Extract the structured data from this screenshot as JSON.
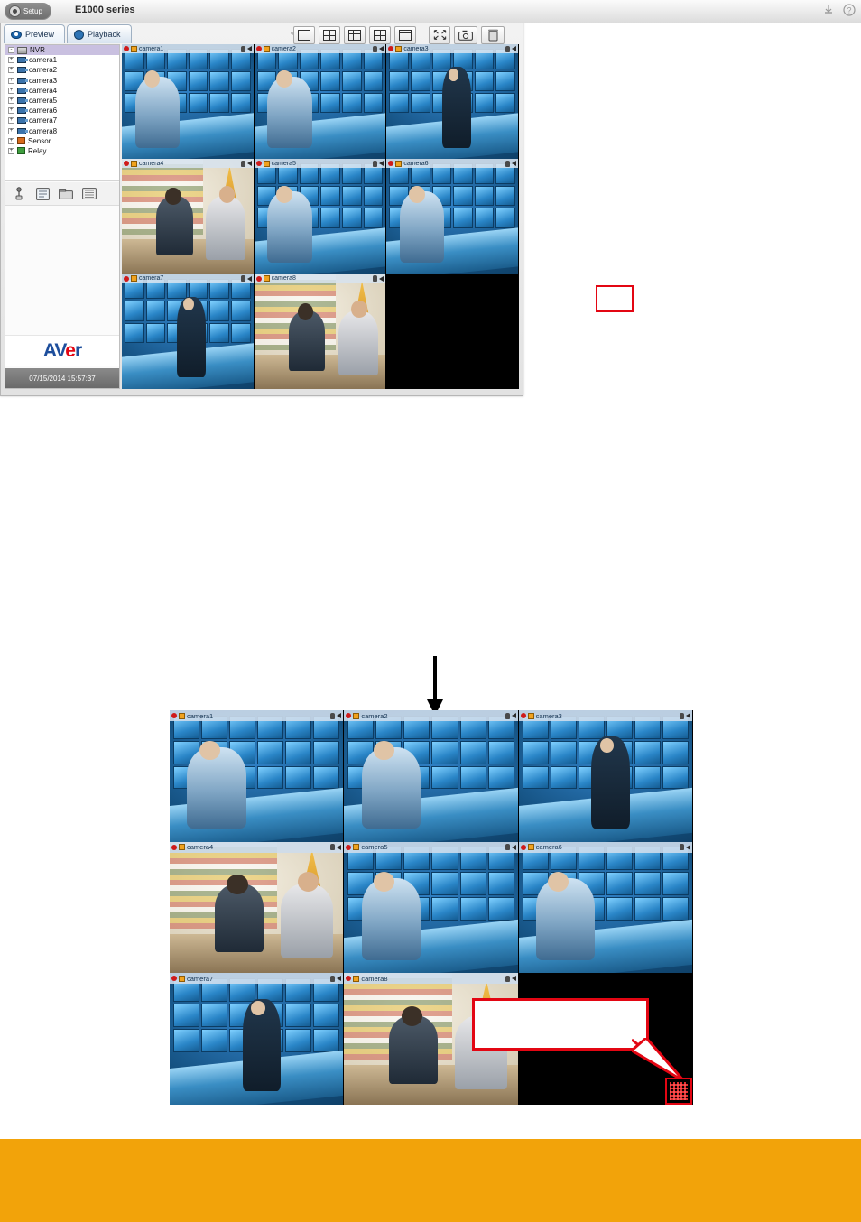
{
  "page": {
    "background": "#ffffff",
    "bottom_band_color": "#f2a30a",
    "highlight_color": "#e30613"
  },
  "callout_icons": {
    "top": {
      "name": "fullscreen-icon",
      "label": ""
    },
    "left": {
      "name": "fullscreen-icon",
      "label": ""
    }
  },
  "app_window": {
    "titlebar": {
      "setup_label": "Setup",
      "title": "E1000 series",
      "icons": [
        "minimize-icon",
        "help-icon"
      ]
    },
    "tabs": [
      {
        "label": "Preview",
        "icon": "eye-icon",
        "active": true
      },
      {
        "label": "Playback",
        "icon": "globe-icon",
        "active": false
      }
    ],
    "viewbar": {
      "collapse_label": "<",
      "buttons": [
        {
          "name": "single-view-button",
          "icon": "layout-1-icon"
        },
        {
          "name": "quad-view-button",
          "icon": "layout-4-icon"
        },
        {
          "name": "nine-view-button",
          "icon": "layout-9-icon"
        },
        {
          "name": "six-view-button",
          "icon": "layout-6-icon"
        },
        {
          "name": "sixteen-view-button",
          "icon": "layout-16-icon"
        },
        {
          "name": "fullscreen-button",
          "icon": "fullscreen-icon"
        },
        {
          "name": "snapshot-button",
          "icon": "camera-icon"
        },
        {
          "name": "delete-button",
          "icon": "trash-icon"
        }
      ]
    },
    "tree": {
      "root": "NVR",
      "items": [
        {
          "label": "camera1",
          "icon": "camera-icon"
        },
        {
          "label": "camera2",
          "icon": "camera-icon"
        },
        {
          "label": "camera3",
          "icon": "camera-icon"
        },
        {
          "label": "camera4",
          "icon": "camera-icon"
        },
        {
          "label": "camera5",
          "icon": "camera-icon"
        },
        {
          "label": "camera6",
          "icon": "camera-icon"
        },
        {
          "label": "camera7",
          "icon": "camera-icon"
        },
        {
          "label": "camera8",
          "icon": "camera-icon"
        },
        {
          "label": "Sensor",
          "icon": "sensor-icon"
        },
        {
          "label": "Relay",
          "icon": "relay-icon"
        }
      ]
    },
    "panel_tools": [
      {
        "name": "ptz-tool-button",
        "icon": "joystick-icon"
      },
      {
        "name": "event-log-tool-button",
        "icon": "log-icon"
      },
      {
        "name": "archive-tool-button",
        "icon": "archive-icon"
      },
      {
        "name": "backup-tool-button",
        "icon": "backup-icon"
      }
    ],
    "logo": "AVer",
    "clock": "07/15/2014 15:57:37",
    "cells": [
      {
        "name": "camera1",
        "scene": "ctrl",
        "recording": true
      },
      {
        "name": "camera2",
        "scene": "ctrl",
        "recording": true
      },
      {
        "name": "camera3",
        "scene": "stand",
        "recording": true
      },
      {
        "name": "camera4",
        "scene": "store",
        "recording": true
      },
      {
        "name": "camera5",
        "scene": "ctrl",
        "recording": true
      },
      {
        "name": "camera6",
        "scene": "ctrl",
        "recording": true
      },
      {
        "name": "camera7",
        "scene": "stand",
        "recording": true
      },
      {
        "name": "camera8",
        "scene": "store",
        "recording": true
      },
      {
        "name": "",
        "scene": "empty",
        "recording": false
      }
    ]
  },
  "fullscreen_view": {
    "cells": [
      {
        "name": "camera1",
        "scene": "ctrl",
        "recording": true
      },
      {
        "name": "camera2",
        "scene": "ctrl",
        "recording": true
      },
      {
        "name": "camera3",
        "scene": "stand",
        "recording": true
      },
      {
        "name": "camera4",
        "scene": "store",
        "recording": true
      },
      {
        "name": "camera5",
        "scene": "ctrl",
        "recording": true
      },
      {
        "name": "camera6",
        "scene": "ctrl",
        "recording": true
      },
      {
        "name": "camera7",
        "scene": "stand",
        "recording": true
      },
      {
        "name": "camera8",
        "scene": "store",
        "recording": true
      },
      {
        "name": "",
        "scene": "empty",
        "recording": false
      }
    ],
    "callout_text": "",
    "restore_button": {
      "name": "exit-fullscreen-button",
      "icon": "qr-icon"
    }
  }
}
